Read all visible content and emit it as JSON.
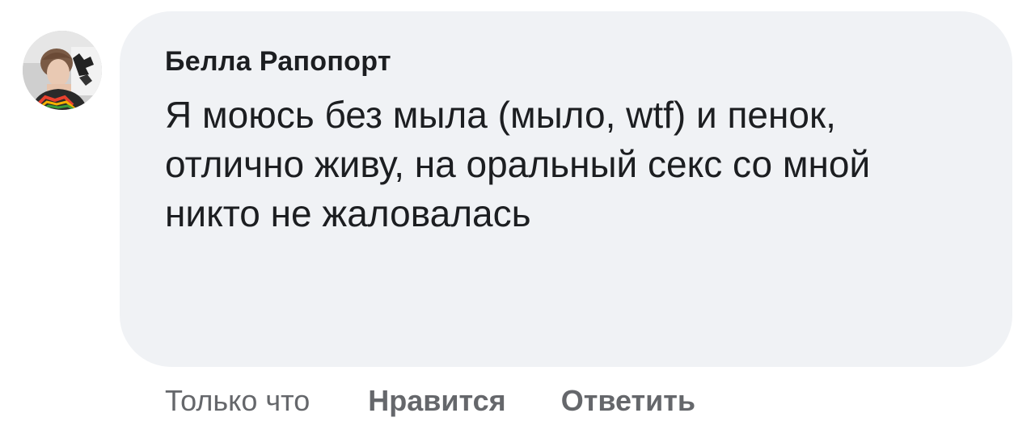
{
  "comment": {
    "author": "Белла Рапопорт",
    "text": "Я моюсь без мыла (мыло, wtf) и пенок, отлично живу, на оральный секс со мной никто не жаловалась",
    "avatar_icon": "profile-photo",
    "timestamp": "Только что",
    "like_label": "Нравится",
    "reply_label": "Ответить"
  },
  "colors": {
    "bubble_background": "#f0f2f5",
    "text": "#1c1e21",
    "meta": "#65676b"
  }
}
